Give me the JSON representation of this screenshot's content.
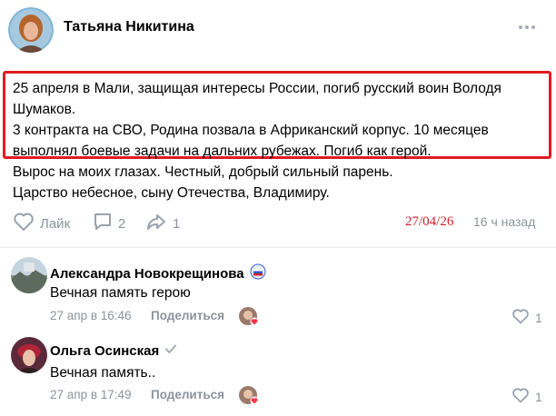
{
  "post": {
    "author": "Татьяна Никитина",
    "highlighted_lines": [
      "25 апреля в Мали, защищая интересы России, погиб русский воин Володя",
      "Шумаков.",
      "3 контракта на СВО, Родина позвала в Африканский корпус. 10 месяцев",
      "выполнял боевые задачи на дальних рубежах. Погиб как герой."
    ],
    "lines": [
      "Вырос на моих глазах. Честный, добрый сильный парень.",
      "Царство небесное, сыну Отечества, Владимиру."
    ],
    "like_label": "Лайк",
    "comments_count": "2",
    "shares_count": "1",
    "date_stamp": "27/04/26",
    "time_ago": "16 ч назад"
  },
  "comments": [
    {
      "name": "Александра Новокрещинова",
      "text": "Вечная память герою",
      "date": "27 апр в 16:46",
      "share_label": "Поделиться",
      "likes": "1"
    },
    {
      "name": "Ольга Осинская",
      "text": "Вечная память..",
      "date": "27 апр в 17:49",
      "share_label": "Поделиться",
      "likes": "1"
    }
  ],
  "colors": {
    "highlight_border": "#e21a22",
    "meta_gray": "#8c939c",
    "date_stamp_red": "#d2202a"
  },
  "icons": [
    "more-icon",
    "heart-icon",
    "comment-icon",
    "share-icon",
    "verified-icon",
    "badge-icon"
  ]
}
